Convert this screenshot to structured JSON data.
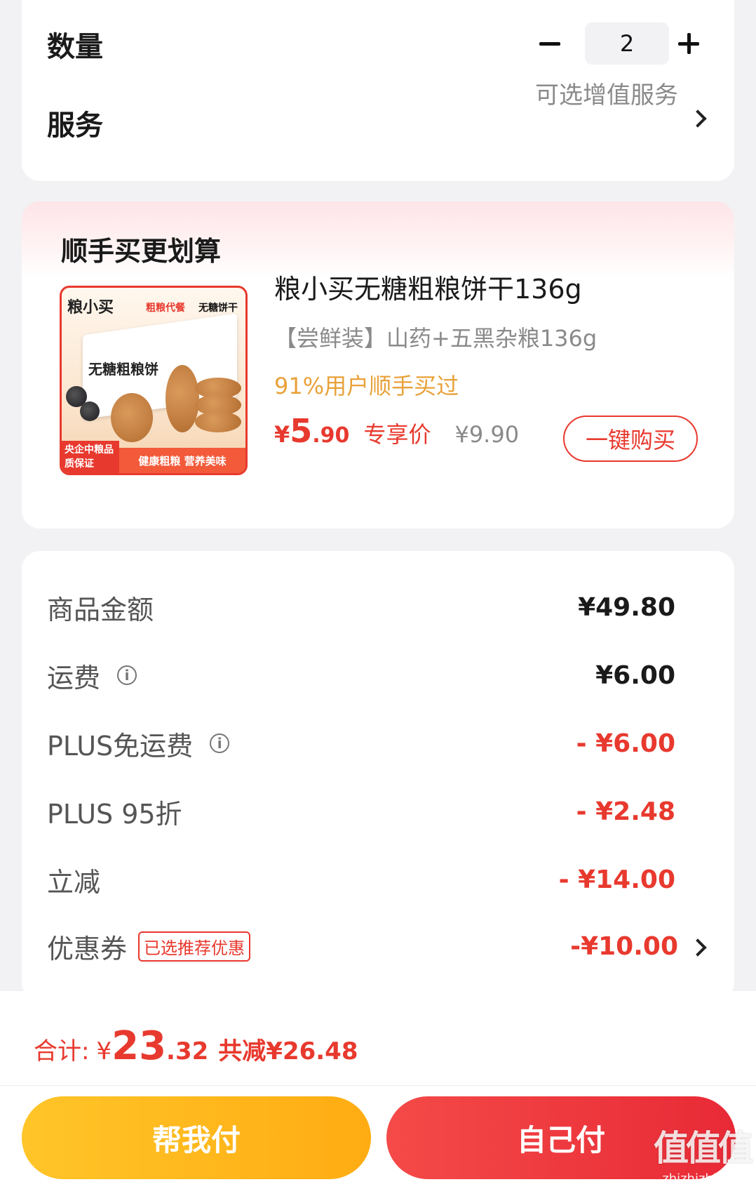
{
  "top": {
    "quantity_label": "数量",
    "quantity_value": "2",
    "service_label": "服务",
    "service_value": "可选增值服务"
  },
  "bundle": {
    "title": "顺手买更划算",
    "image": {
      "brand": "粮小买",
      "tag_red": "粗粮代餐",
      "tag_black": "无糖饼干",
      "box_name": "无糖粗粮饼",
      "badge_left": "央企中粮品质保证",
      "badge_bar": "健康粗粮 营养美味"
    },
    "product_name": "粮小买无糖粗粮饼干136g",
    "product_spec": "【尝鲜装】山药+五黑杂粮136g",
    "social_proof": "91%用户顺手买过",
    "price_yen": "¥",
    "price_int": "5",
    "price_dec": ".90",
    "price_tag": "专享价",
    "original_price": "¥9.90",
    "buy_button": "一键购买"
  },
  "detail": {
    "rows": [
      {
        "label": "商品金额",
        "value": "¥49.80"
      },
      {
        "label": "运费",
        "value": "¥6.00"
      },
      {
        "label": "PLUS免运费",
        "value": "- ¥6.00"
      },
      {
        "label": "PLUS 95折",
        "value": "- ¥2.48"
      },
      {
        "label": "立减",
        "value": "- ¥14.00"
      },
      {
        "label": "优惠券",
        "value": "-¥10.00"
      }
    ],
    "coupon_tag": "已选推荐优惠"
  },
  "bottom": {
    "total_label": "合计:",
    "total_yen": "¥",
    "total_int": "23",
    "total_dec": ".32",
    "total_saved": "共减¥26.48",
    "help_pay": "帮我付",
    "self_pay": "自己付"
  },
  "watermark": {
    "logo": "值值值",
    "url": "zhizhizhi.com"
  },
  "colors": {
    "accent_red": "#e8392e",
    "orange": "#e8a13a",
    "yellow_button": "#ffb81c",
    "red_button": "#ee3a3e"
  }
}
